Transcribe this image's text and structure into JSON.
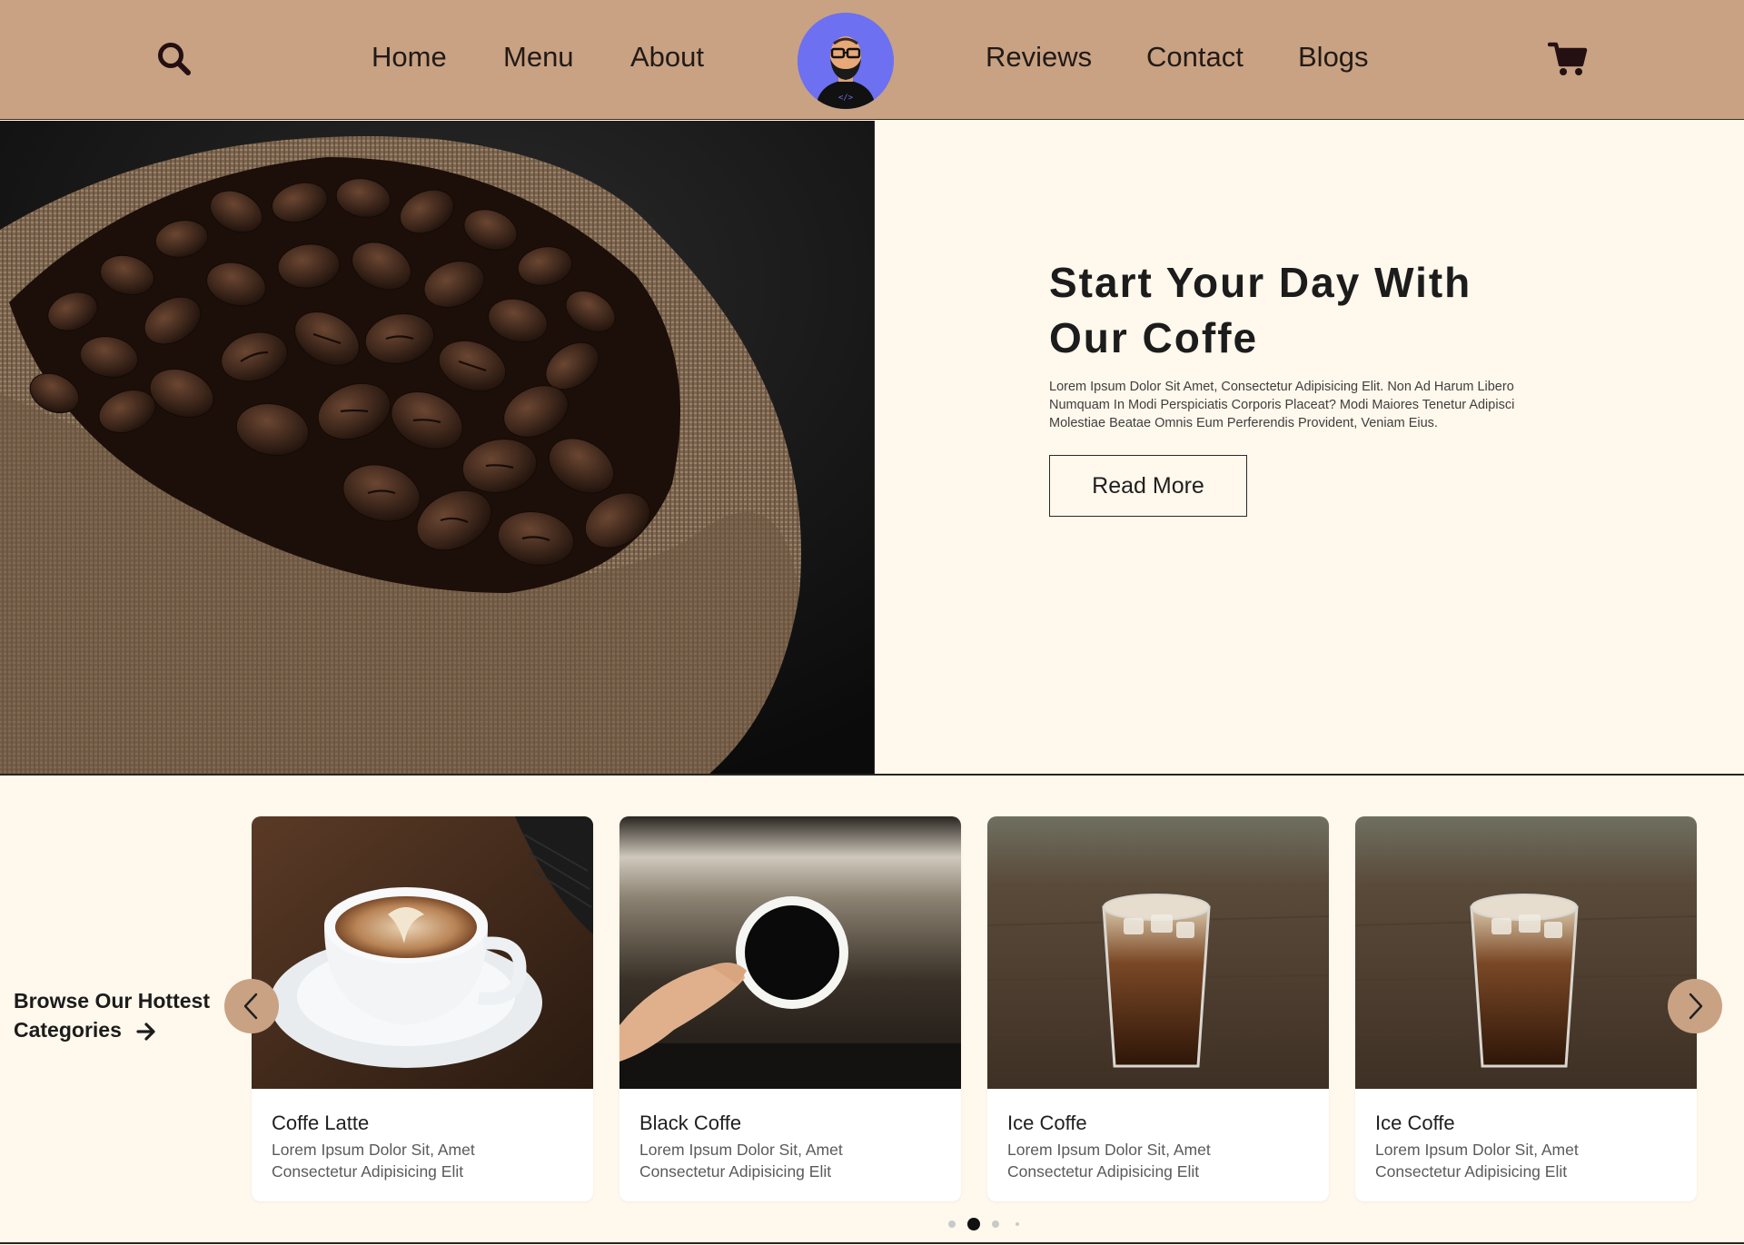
{
  "header": {
    "nav_left": [
      "Home",
      "Menu",
      "About"
    ],
    "nav_right": [
      "Reviews",
      "Contact",
      "Blogs"
    ],
    "icons": {
      "search": "search-icon",
      "cart": "cart-icon",
      "logo": "developer-avatar-logo"
    }
  },
  "hero": {
    "title_line1": "Start Your Day With",
    "title_line2": "Our Coffe",
    "description": "Lorem Ipsum Dolor Sit Amet, Consectetur Adipisicing Elit. Non Ad Harum Libero Numquam In Modi Perspiciatis Corporis Placeat? Modi Maiores Tenetur Adipisci Molestiae Beatae Omnis Eum Perferendis Provident, Veniam Eius.",
    "button_label": "Read More"
  },
  "categories": {
    "heading_line1": "Browse Our Hottest",
    "heading_line2": "Categories",
    "cards": [
      {
        "title": "Coffe Latte",
        "desc_line1": "Lorem Ipsum Dolor Sit, Amet",
        "desc_line2": "Consectetur Adipisicing Elit"
      },
      {
        "title": "Black Coffe",
        "desc_line1": "Lorem Ipsum Dolor Sit, Amet",
        "desc_line2": "Consectetur Adipisicing Elit"
      },
      {
        "title": "Ice Coffe",
        "desc_line1": "Lorem Ipsum Dolor Sit, Amet",
        "desc_line2": "Consectetur Adipisicing Elit"
      },
      {
        "title": "Ice Coffe",
        "desc_line1": "Lorem Ipsum Dolor Sit, Amet",
        "desc_line2": "Consectetur Adipisicing Elit"
      }
    ],
    "pagination": {
      "total": 4,
      "active": 2
    }
  },
  "colors": {
    "header_bg": "#c8a283",
    "page_bg": "#fff8ec",
    "accent": "#c8a283",
    "text_dark": "#1c1c1c"
  }
}
